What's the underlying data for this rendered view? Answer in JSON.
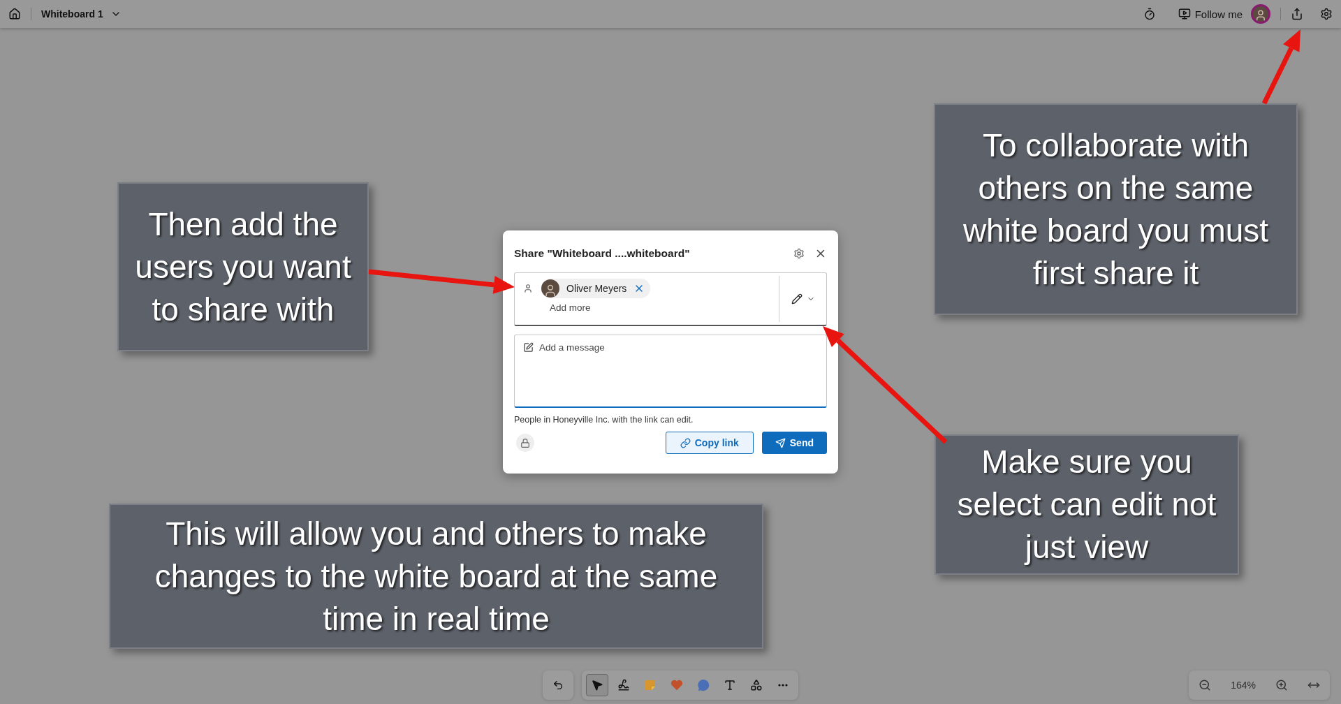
{
  "top_bar": {
    "title": "Whiteboard 1",
    "follow_label": "Follow me"
  },
  "annotations": [
    {
      "text": "To collaborate with others on the same white board you must first share it"
    },
    {
      "text": "Then add the users you want to share with"
    },
    {
      "text": "Make sure you select can edit not just view"
    },
    {
      "text": "This will allow you and others to make changes to the white board at the same time in real time"
    }
  ],
  "share_dialog": {
    "title": "Share \"Whiteboard ....whiteboard\"",
    "recipients": [
      {
        "name": "Oliver Meyers"
      }
    ],
    "add_more_placeholder": "Add more",
    "message_placeholder": "Add a message",
    "permission_note": "People in Honeyville Inc. with the link can edit.",
    "copy_link_label": "Copy link",
    "send_label": "Send"
  },
  "toolbar": {
    "tools": [
      {
        "kind": "select",
        "selected": true
      },
      {
        "kind": "pen",
        "selected": false
      },
      {
        "kind": "sticky",
        "selected": false
      },
      {
        "kind": "reaction",
        "selected": false
      },
      {
        "kind": "comment",
        "selected": false
      },
      {
        "kind": "text",
        "selected": false
      },
      {
        "kind": "shapes",
        "selected": false
      },
      {
        "kind": "more",
        "selected": false
      }
    ]
  },
  "zoom_controls": {
    "level_label": "164%"
  }
}
